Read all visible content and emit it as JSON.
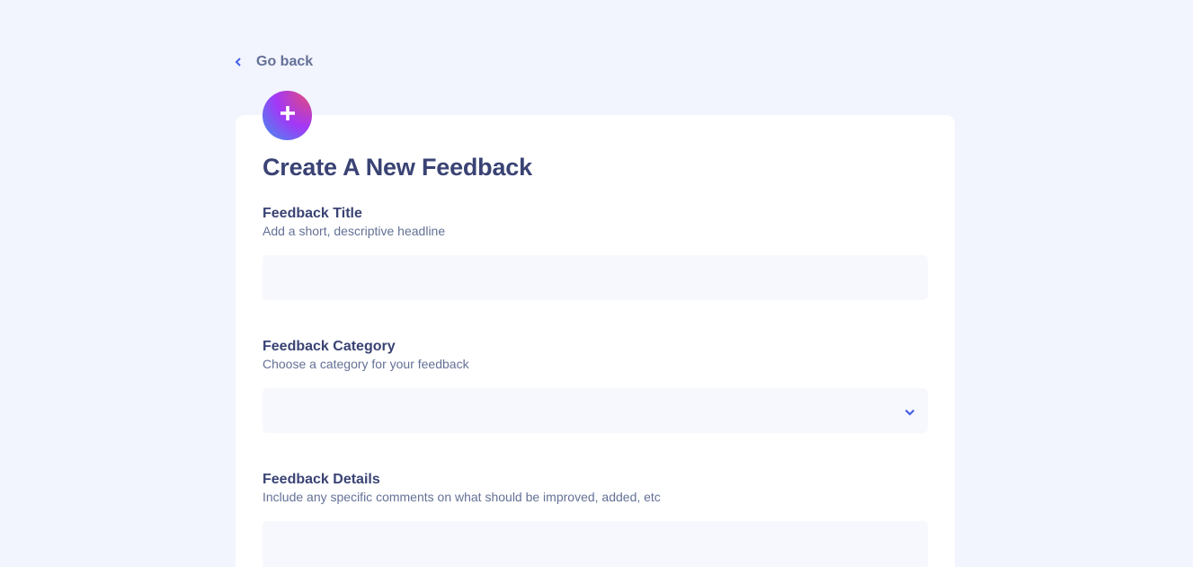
{
  "nav": {
    "go_back_label": "Go back",
    "go_back_icon": "chevron-left-icon"
  },
  "form": {
    "badge_icon": "plus-icon",
    "title": "Create A New Feedback",
    "fields": {
      "title": {
        "label": "Feedback Title",
        "hint": "Add a short, descriptive headline",
        "value": "",
        "placeholder": ""
      },
      "category": {
        "label": "Feedback Category",
        "hint": "Choose a category for your feedback",
        "selected_value": "",
        "icon": "chevron-down-icon"
      },
      "details": {
        "label": "Feedback Details",
        "hint": "Include any specific comments on what should be improved, added, etc",
        "value": "",
        "placeholder": ""
      }
    }
  },
  "colors": {
    "page_background": "#f2f4fe",
    "card_background": "#ffffff",
    "heading": "#3a4374",
    "muted_text": "#647196",
    "accent_blue": "#4661e6",
    "input_background": "#f7f8fd"
  }
}
